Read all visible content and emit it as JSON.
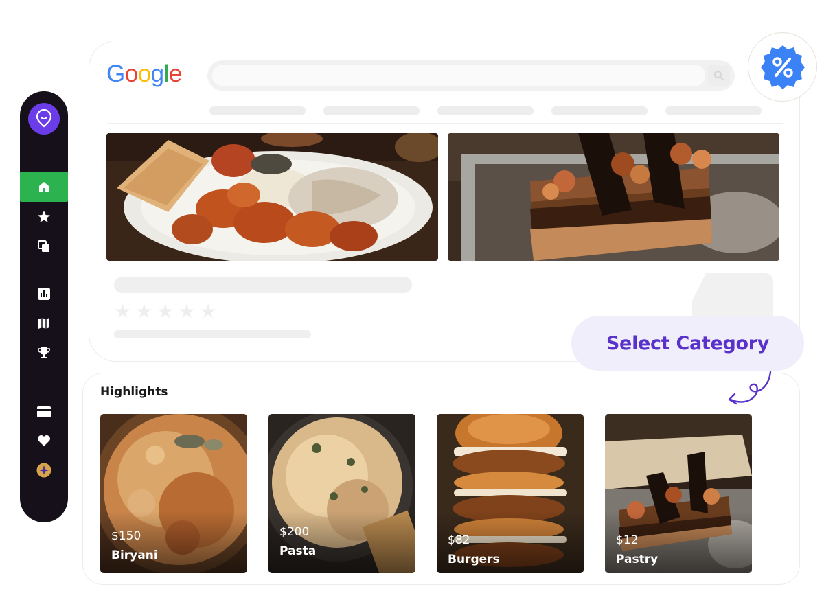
{
  "search_card": {
    "logo_letters": [
      {
        "char": "G",
        "color": "#4285f4"
      },
      {
        "char": "o",
        "color": "#ea4335"
      },
      {
        "char": "o",
        "color": "#fbbc05"
      },
      {
        "char": "g",
        "color": "#4285f4"
      },
      {
        "char": "l",
        "color": "#34a853"
      },
      {
        "char": "e",
        "color": "#ea4335"
      }
    ],
    "search_icon": "search-icon",
    "hero_images": [
      "grilled-chicken-platter-image",
      "chocolate-pastry-image"
    ],
    "rating_icons": [
      "star-icon",
      "star-icon",
      "star-icon",
      "star-icon",
      "star-icon"
    ]
  },
  "sidebar": {
    "logo_icon": "location-pin-logo-icon",
    "items": [
      {
        "icon": "home-icon",
        "active": true
      },
      {
        "icon": "star-icon",
        "active": false
      },
      {
        "icon": "copy-icon",
        "active": false
      },
      {
        "icon": "bar-chart-icon",
        "active": false
      },
      {
        "icon": "map-icon",
        "active": false
      },
      {
        "icon": "trophy-icon",
        "active": false
      },
      {
        "icon": "card-icon",
        "active": false
      },
      {
        "icon": "heart-icon",
        "active": false
      },
      {
        "icon": "sparkle-badge-icon",
        "active": false
      }
    ]
  },
  "discount_badge": {
    "icon": "percent-badge-icon",
    "color": "#3b82f6"
  },
  "category": {
    "label": "Select Category",
    "color": "#5932c9",
    "arrow_icon": "curly-arrow-icon"
  },
  "highlights": {
    "title": "Highlights",
    "items": [
      {
        "price": "$150",
        "name": "Biryani",
        "image": "biryani-image"
      },
      {
        "price": "$200",
        "name": "Pasta",
        "image": "pasta-image"
      },
      {
        "price": "$82",
        "name": "Burgers",
        "image": "burgers-image"
      },
      {
        "price": "$12",
        "name": "Pastry",
        "image": "pastry-image"
      }
    ]
  },
  "colors": {
    "sidebar_bg": "#16101a",
    "sidebar_active": "#2cb34f",
    "brand_purple": "#6a3de8"
  }
}
